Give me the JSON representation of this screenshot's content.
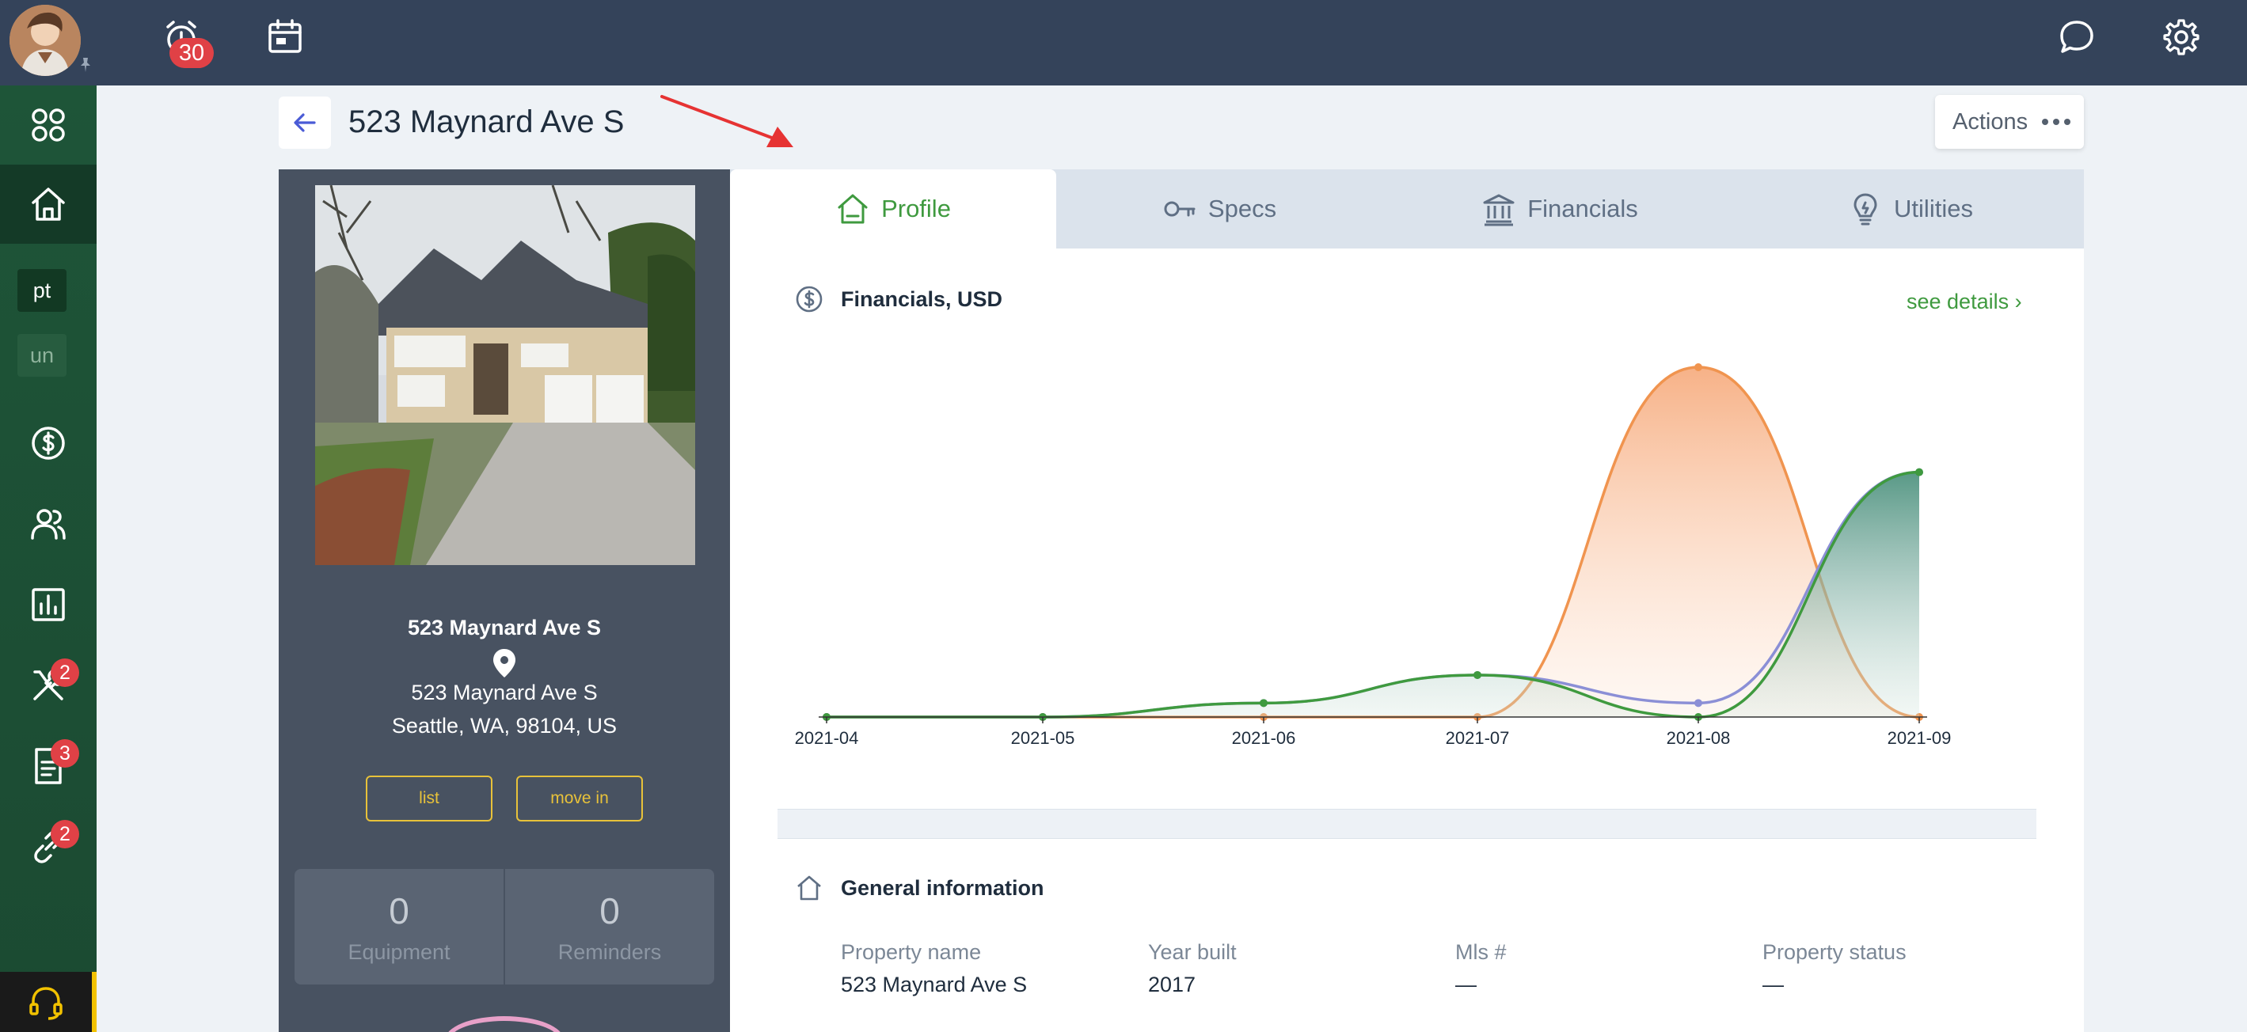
{
  "topbar": {
    "notifications_count": "30"
  },
  "sidebar": {
    "chips": [
      {
        "label": "pt"
      },
      {
        "label": "un"
      }
    ],
    "badges": {
      "tools": "2",
      "documents": "3",
      "links": "2"
    }
  },
  "header": {
    "title": "523 Maynard Ave S",
    "actions_label": "Actions"
  },
  "property_panel": {
    "name": "523 Maynard Ave S",
    "address_line1": "523 Maynard Ave S",
    "address_line2": "Seattle, WA, 98104, US",
    "list_button": "list",
    "move_in_button": "move in",
    "stats": [
      {
        "value": "0",
        "label": "Equipment"
      },
      {
        "value": "0",
        "label": "Reminders"
      }
    ]
  },
  "tabs": [
    {
      "label": "Profile",
      "active": true
    },
    {
      "label": "Specs",
      "active": false
    },
    {
      "label": "Financials",
      "active": false
    },
    {
      "label": "Utilities",
      "active": false
    }
  ],
  "financials": {
    "title": "Financials, USD",
    "see_details": "see details"
  },
  "chart_data": {
    "type": "area",
    "x": [
      "2021-04",
      "2021-05",
      "2021-06",
      "2021-07",
      "2021-08",
      "2021-09"
    ],
    "series": [
      {
        "color": "#f0944f",
        "values": [
          0,
          0,
          0,
          0,
          100,
          0
        ]
      },
      {
        "color": "#8b8fd6",
        "values": [
          0,
          0,
          4,
          12,
          4,
          70
        ]
      },
      {
        "color": "#3f9a3f",
        "values": [
          0,
          0,
          4,
          12,
          0,
          70
        ]
      }
    ],
    "ylim": [
      0,
      100
    ],
    "grid": false,
    "legend": "none"
  },
  "general_info": {
    "title": "General information",
    "fields": [
      {
        "label": "Property name",
        "value": "523 Maynard Ave S"
      },
      {
        "label": "Year built",
        "value": "2017"
      },
      {
        "label": "Mls #",
        "value": "—"
      },
      {
        "label": "Property status",
        "value": "—"
      }
    ]
  },
  "colors": {
    "topbar": "#34435a",
    "sidebar": "#1e5538",
    "accent_green": "#3f9a3f",
    "badge_red": "#e04146",
    "panel_dark": "#485261",
    "button_yellow": "#e8c23a"
  }
}
